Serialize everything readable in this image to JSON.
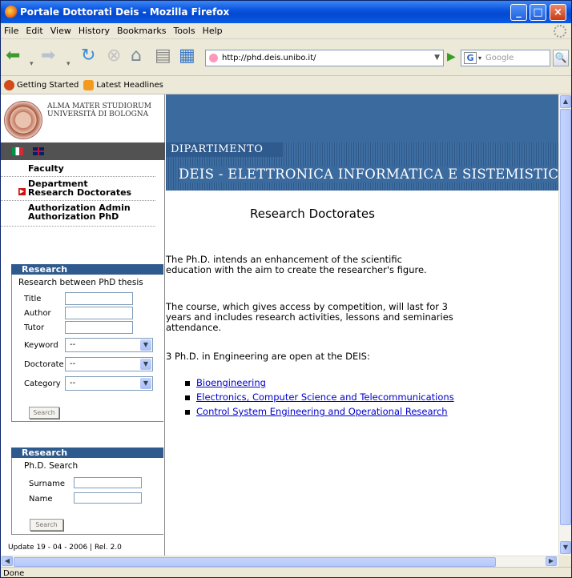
{
  "window": {
    "title": "Portale Dottorati Deis - Mozilla Firefox",
    "minimize": "_",
    "maximize": "□",
    "close": "×"
  },
  "menu": [
    "File",
    "Edit",
    "View",
    "History",
    "Bookmarks",
    "Tools",
    "Help"
  ],
  "navbar": {
    "url": "http://phd.deis.unibo.it/",
    "search_placeholder": "Google",
    "search_engine": "G"
  },
  "bookmarks": [
    "Getting Started",
    "Latest Headlines"
  ],
  "logo": {
    "line1": "ALMA MATER STUDIORUM",
    "line2": "UNIVERSITÀ DI BOLOGNA"
  },
  "left_nav": {
    "faculty": "Faculty",
    "department": "Department",
    "research_doctorates": "Research Doctorates",
    "auth_admin": "Authorization Admin",
    "auth_phd": "Authorization PhD"
  },
  "research_panel": {
    "header": "Research",
    "subtitle": "Research between PhD thesis",
    "title_label": "Title",
    "author_label": "Author",
    "tutor_label": "Tutor",
    "keyword_label": "Keyword",
    "doctorate_label": "Doctorate",
    "category_label": "Category",
    "select_value": "--",
    "search_button": "Search"
  },
  "phd_panel": {
    "header": "Research",
    "subtitle": "Ph.D. Search",
    "surname_label": "Surname",
    "name_label": "Name",
    "search_button": "Search"
  },
  "update": "Update 19 - 04 - 2006 | Rel. 2.0",
  "banner": {
    "dipartimento": "DIPARTIMENTO",
    "deis": "DEIS - ELETTRONICA INFORMATICA E SISTEMISTICA"
  },
  "main": {
    "title": "Research Doctorates",
    "p1_line1": "The Ph.D. intends an enhancement of the scientific",
    "p1_line2": "education with the aim to create the researcher's figure.",
    "p2_line1": "The course, which gives access by competition, will last for 3",
    "p2_line2": "years and includes research activities, lessons and seminaries",
    "p2_line3": "attendance.",
    "p3": "3 Ph.D. in Engineering are open at the DEIS:",
    "links": [
      "Bioengineering",
      "Electronics, Computer Science and Telecommunications",
      "Control System Engineering and Operational Research"
    ]
  },
  "status": "Done"
}
